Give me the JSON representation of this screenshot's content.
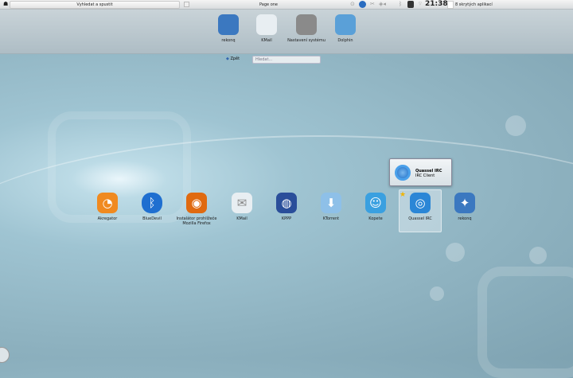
{
  "topbar": {
    "task_label": "Vyhledat a spustit",
    "page_label": "Page one",
    "clock": "21:38",
    "hidden_apps": "8 skrytých aplikací"
  },
  "favorites": [
    {
      "label": "rekonq",
      "icon": "rekonq-icon",
      "color": "#3b78c0"
    },
    {
      "label": "KMail",
      "icon": "kmail-icon",
      "color": "#e8eef2"
    },
    {
      "label": "Nastavení systému",
      "icon": "settings-icon",
      "color": "#8a8a8a"
    },
    {
      "label": "Dolphin",
      "icon": "dolphin-icon",
      "color": "#5aa0d8"
    }
  ],
  "search": {
    "back_label": "Zpět",
    "placeholder": "Hledat..."
  },
  "apps": [
    {
      "label": "Akregator",
      "icon": "akregator-icon",
      "color": "#f08a20",
      "glyph": "◔"
    },
    {
      "label": "BlueDevil",
      "icon": "bluetooth-icon",
      "color": "#1f6fd0",
      "glyph": "ᛒ"
    },
    {
      "label": "Instalátor prohlížeče Mozilla Firefox",
      "icon": "firefox-icon",
      "color": "#e06a10",
      "glyph": "◉"
    },
    {
      "label": "KMail",
      "icon": "kmail-icon",
      "color": "#e8eef2",
      "glyph": "✉"
    },
    {
      "label": "KPPP",
      "icon": "kppp-icon",
      "color": "#2a4e9a",
      "glyph": "◍"
    },
    {
      "label": "KTorrent",
      "icon": "ktorrent-icon",
      "color": "#8ec0e8",
      "glyph": "⬇"
    },
    {
      "label": "Kopete",
      "icon": "kopete-icon",
      "color": "#3aa0e0",
      "glyph": "☺"
    },
    {
      "label": "Quassel IRC",
      "icon": "quassel-icon",
      "color": "#2b86d6",
      "glyph": "◎"
    },
    {
      "label": "rekonq",
      "icon": "rekonq-icon",
      "color": "#3b78c0",
      "glyph": "✦"
    }
  ],
  "tooltip": {
    "title": "Quassel IRC",
    "subtitle": "IRC Client"
  }
}
